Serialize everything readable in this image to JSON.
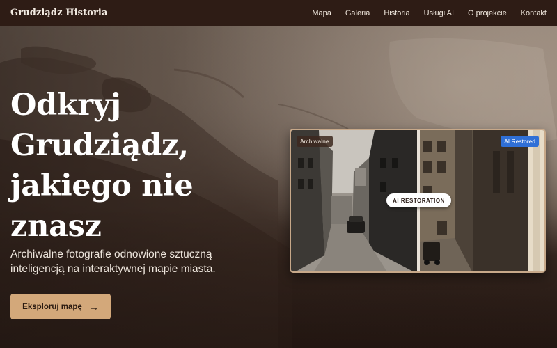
{
  "navbar": {
    "brand": "Grudziądz Historia",
    "links": [
      "Mapa",
      "Galeria",
      "Historia",
      "Usługi AI",
      "O projekcie",
      "Kontakt"
    ]
  },
  "hero": {
    "headline_lines": [
      "Odkryj",
      "Grudziądz,",
      "jakiego nie",
      "znasz"
    ],
    "subtitle": "Archiwalne fotografie odnowione sztuczną inteligencją na interaktywnej mapie miasta.",
    "cta_label": "Eksploruj mapę",
    "cta_icon": "arrow-right-icon"
  },
  "comparison": {
    "before_label": "Archiwalne",
    "after_label": "AI Restored",
    "handle_label": "AI RESTORATION"
  },
  "colors": {
    "navbar_bg": "#2e1c15",
    "accent": "#d3a87a",
    "ai_badge": "#2f6fd6"
  }
}
